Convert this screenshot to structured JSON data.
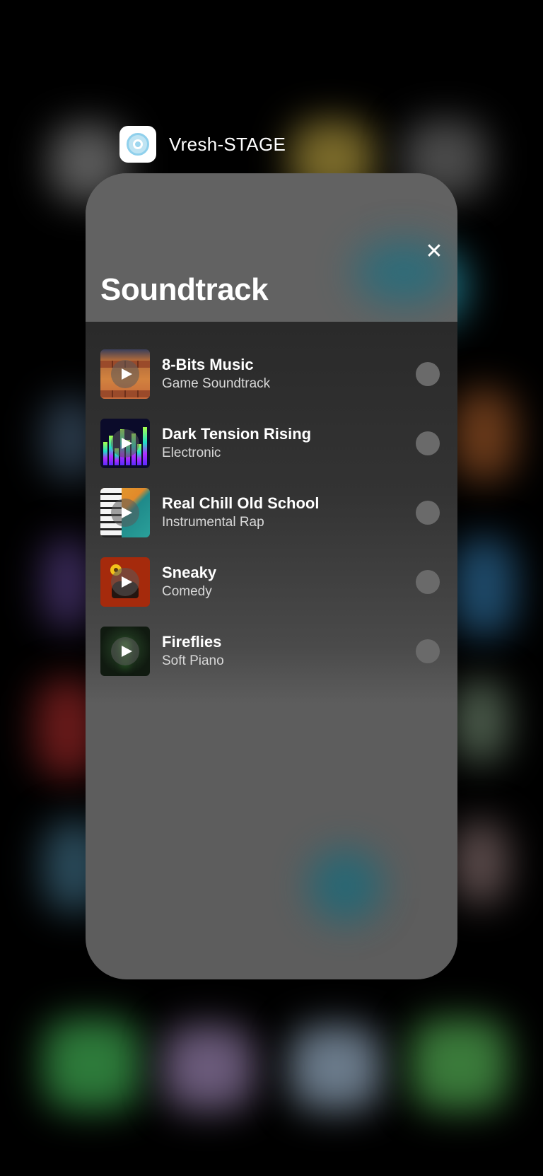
{
  "app": {
    "name": "Vresh-STAGE",
    "icon": "vresh-app-icon"
  },
  "sheet": {
    "title": "Soundtrack",
    "close_icon": "close-icon",
    "close_glyph": "✕"
  },
  "tracks": [
    {
      "name": "8-Bits Music",
      "genre": "Game Soundtrack",
      "thumbnail": "pixel-game-scene"
    },
    {
      "name": "Dark Tension Rising",
      "genre": "Electronic",
      "thumbnail": "equalizer-bars"
    },
    {
      "name": "Real Chill Old School",
      "genre": "Instrumental Rap",
      "thumbnail": "piano-keys-art"
    },
    {
      "name": "Sneaky",
      "genre": "Comedy",
      "thumbnail": "bowler-hat-flower"
    },
    {
      "name": "Fireflies",
      "genre": "Soft Piano",
      "thumbnail": "dark-forest-glow"
    }
  ],
  "colors": {
    "card": "#5d5d5d",
    "radio": "#6a6a6a",
    "text_primary": "#ffffff",
    "text_secondary": "#d8d8d8"
  }
}
